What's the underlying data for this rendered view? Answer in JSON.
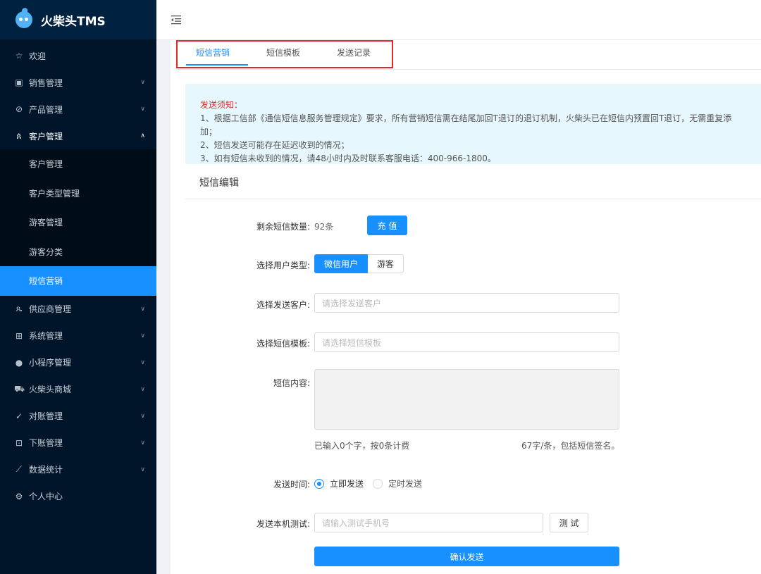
{
  "app": {
    "title": "火柴头TMS"
  },
  "sidebar": {
    "items": [
      {
        "label": "欢迎",
        "icon": "star-icon"
      },
      {
        "label": "销售管理",
        "icon": "sales-icon"
      },
      {
        "label": "产品管理",
        "icon": "compass-icon"
      },
      {
        "label": "客户管理",
        "icon": "users-icon"
      },
      {
        "label": "供应商管理",
        "icon": "network-icon"
      },
      {
        "label": "系统管理",
        "icon": "grid-icon"
      },
      {
        "label": "小程序管理",
        "icon": "wechat-icon"
      },
      {
        "label": "火柴头商城",
        "icon": "cart-icon"
      },
      {
        "label": "对账管理",
        "icon": "check-icon"
      },
      {
        "label": "下账管理",
        "icon": "ledger-icon"
      },
      {
        "label": "数据统计",
        "icon": "chart-icon"
      },
      {
        "label": "个人中心",
        "icon": "gear-icon"
      }
    ],
    "submenu": [
      {
        "label": "客户管理"
      },
      {
        "label": "客户类型管理"
      },
      {
        "label": "游客管理"
      },
      {
        "label": "游客分类"
      },
      {
        "label": "短信营销"
      }
    ]
  },
  "tabs": [
    {
      "label": "短信营销"
    },
    {
      "label": "短信模板"
    },
    {
      "label": "发送记录"
    }
  ],
  "notice": {
    "title": "发送须知：",
    "lines": [
      "1、根据工信部《通信短信息服务管理规定》要求，所有营销短信需在结尾加回T退订的退订机制，火柴头已在短信内预置回T退订，无需重复添加；",
      "2、短信发送可能存在延迟收到的情况；",
      "3、如有短信未收到的情况，请48小时内及时联系客服电话：400-966-1800。"
    ]
  },
  "form": {
    "section_title": "短信编辑",
    "balance_label": "剩余短信数量:",
    "balance_value": "92条",
    "recharge_label": "充 值",
    "user_type_label": "选择用户类型:",
    "user_type_options": [
      "微信用户",
      "游客"
    ],
    "customer_label": "选择发送客户:",
    "customer_placeholder": "请选择发送客户",
    "template_label": "选择短信模板:",
    "template_placeholder": "请选择短信模板",
    "content_label": "短信内容:",
    "count_hint": "已输入0个字，按0条计费",
    "rule_hint": "67字/条，包括短信签名。",
    "send_time_label": "发送时间:",
    "send_time_options": [
      "立即发送",
      "定时发送"
    ],
    "test_label": "发送本机测试:",
    "test_placeholder": "请输入测试手机号",
    "test_button": "测 试",
    "submit_button": "确认发送"
  },
  "colors": {
    "primary": "#1890ff",
    "sidebar_bg": "#001529",
    "notice_bg": "#e6f7fe",
    "highlight_border": "#e02a2a"
  }
}
